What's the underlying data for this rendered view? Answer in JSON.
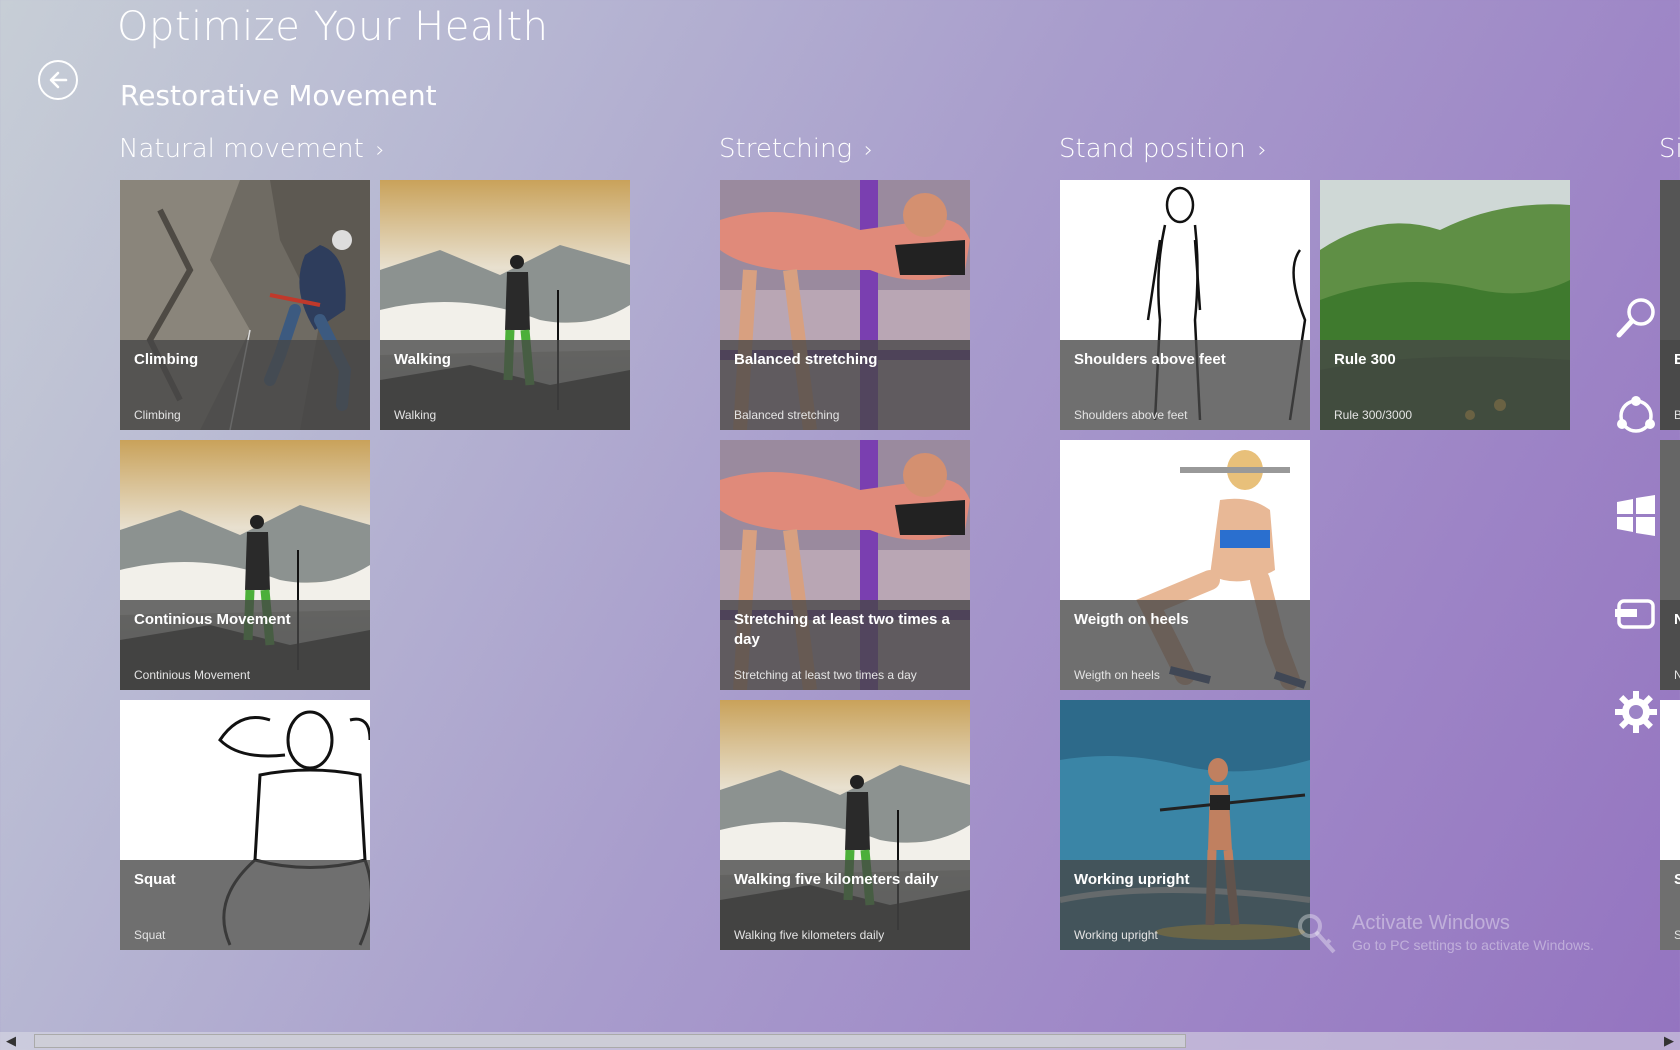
{
  "app": {
    "title": "Optimize Your Health",
    "subtitle": "Restorative Movement"
  },
  "groups": [
    {
      "header": "Natural movement",
      "tiles": [
        {
          "title": "Climbing",
          "subtitle": "Climbing",
          "image": "rock-climber"
        },
        {
          "title": "Walking",
          "subtitle": "Walking",
          "image": "hiker-mountains"
        },
        {
          "title": "Continious Movement",
          "subtitle": "Continious Movement",
          "image": "hiker-mountains"
        },
        {
          "title": "Squat",
          "subtitle": "Squat",
          "image": "squat-sketch"
        }
      ]
    },
    {
      "header": "Stretching",
      "tiles": [
        {
          "title": "Balanced stretching",
          "subtitle": "Balanced stretching",
          "image": "woman-stretching"
        },
        {
          "title": "Stretching at least two times a day",
          "subtitle": "Stretching at least two times a day",
          "image": "woman-stretching"
        },
        {
          "title": "Walking five kilometers daily",
          "subtitle": "Walking five kilometers daily",
          "image": "hiker-mountains"
        }
      ]
    },
    {
      "header": "Stand position",
      "tiles": [
        {
          "title": "Shoulders above feet",
          "subtitle": "Shoulders above feet",
          "image": "standing-sketch"
        },
        {
          "title": "Rule 300",
          "subtitle": "Rule 300/3000",
          "image": "green-hills"
        },
        {
          "title": "Weigth on heels",
          "subtitle": "Weigth on heels",
          "image": "woman-squat-weight"
        },
        {
          "title": "Working upright",
          "subtitle": "Working upright",
          "image": "paddleboard"
        }
      ]
    },
    {
      "header": "Si",
      "tiles": [
        {
          "title": "B",
          "subtitle": "B",
          "image": "partial"
        },
        {
          "title": "N",
          "subtitle": "N",
          "image": "partial"
        },
        {
          "title": "S",
          "subtitle": "S",
          "image": "partial"
        }
      ]
    }
  ],
  "charms": [
    "search-icon",
    "share-icon",
    "start-icon",
    "devices-icon",
    "settings-icon"
  ],
  "watermark": {
    "line1": "Activate Windows",
    "line2": "Go to PC settings to activate Windows."
  },
  "scroll": {
    "position": 0.66
  },
  "colors": {
    "bg_start": "#c7ced6",
    "bg_end": "#9474c0",
    "tile_overlay": "#464646"
  }
}
